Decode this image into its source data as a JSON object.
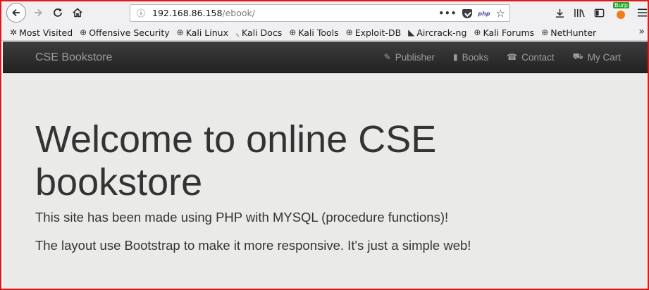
{
  "browser": {
    "url_host": "192.168.86.158",
    "url_path": "/ebook/",
    "url_actions": {
      "more": "•••",
      "php_label": "php",
      "bookmark_star": "☆"
    },
    "burp_badge": "Burp",
    "bookmarks": [
      {
        "label": "Most Visited",
        "icon": "gear-icon"
      },
      {
        "label": "Offensive Security",
        "icon": "globe-icon"
      },
      {
        "label": "Kali Linux",
        "icon": "globe-icon"
      },
      {
        "label": "Kali Docs",
        "icon": "kali-dragon-icon"
      },
      {
        "label": "Kali Tools",
        "icon": "globe-icon"
      },
      {
        "label": "Exploit-DB",
        "icon": "globe-icon"
      },
      {
        "label": "Aircrack-ng",
        "icon": "aircrack-icon"
      },
      {
        "label": "Kali Forums",
        "icon": "globe-icon"
      },
      {
        "label": "NetHunter",
        "icon": "globe-icon"
      }
    ],
    "bookmarks_overflow": "»"
  },
  "site": {
    "brand": "CSE Bookstore",
    "nav": [
      {
        "label": "Publisher",
        "icon": "paperclip-icon"
      },
      {
        "label": "Books",
        "icon": "book-icon"
      },
      {
        "label": "Contact",
        "icon": "phone-icon"
      },
      {
        "label": "My Cart",
        "icon": "cart-icon"
      }
    ]
  },
  "jumbotron": {
    "heading": "Welcome to online CSE bookstore",
    "paragraph1": "This site has been made using PHP with MYSQL (procedure functions)!",
    "paragraph2": "The layout use Bootstrap to make it more responsive. It's just a simple web!"
  },
  "colors": {
    "navbar": "#222222",
    "nav_text": "#9d9d9d",
    "jumbotron_bg": "#eaebe9",
    "frame_border": "#e01818"
  }
}
